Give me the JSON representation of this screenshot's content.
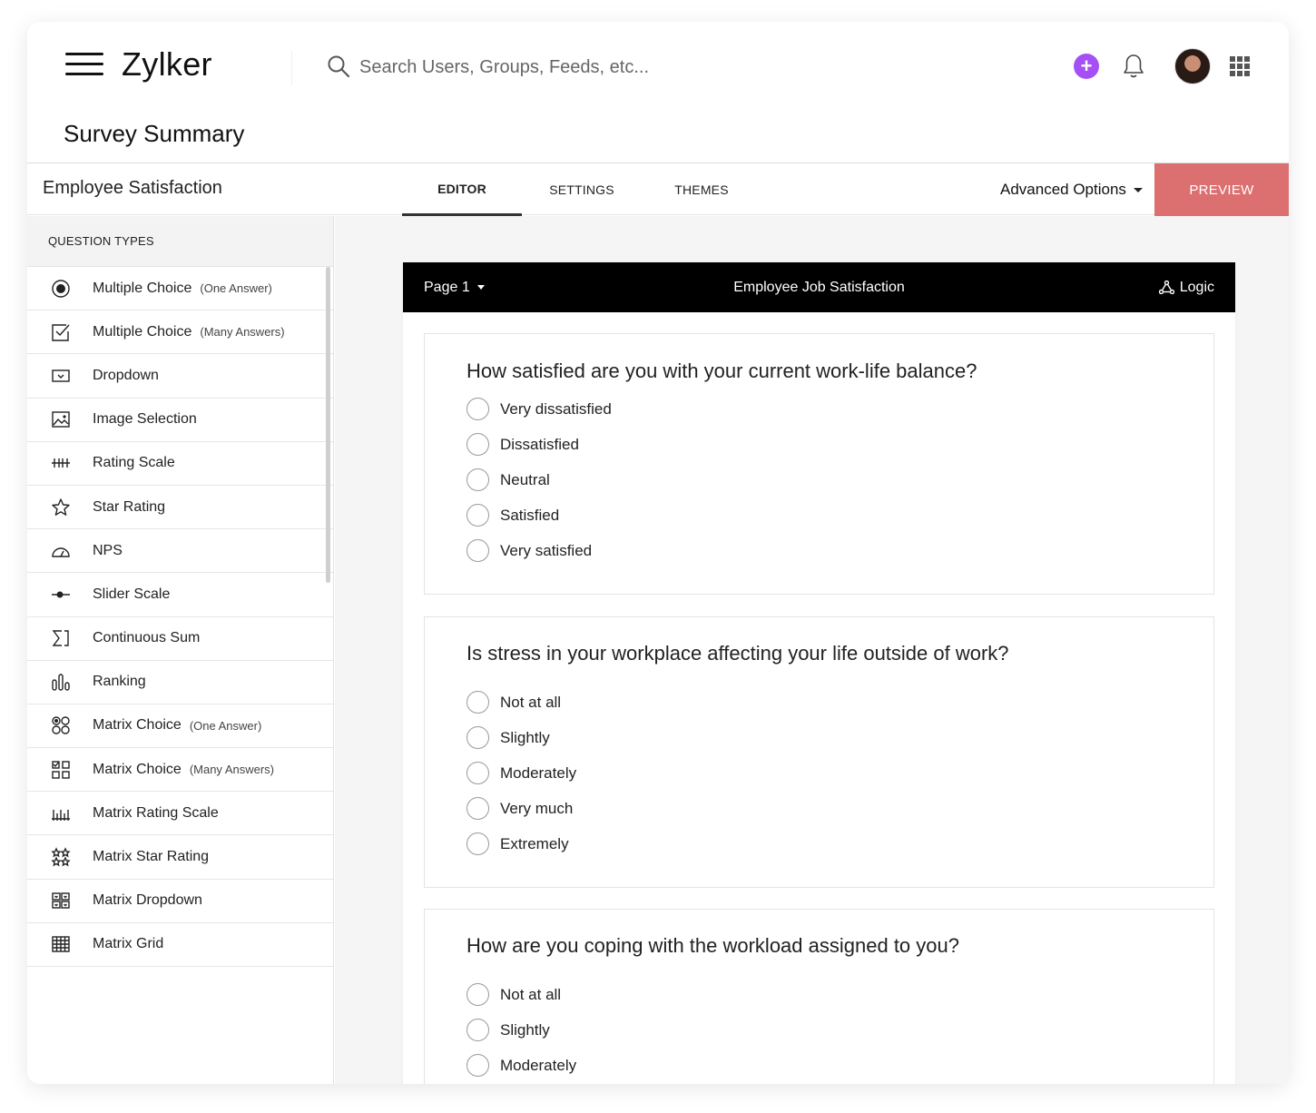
{
  "header": {
    "logo": "Zylker",
    "search_placeholder": "Search Users, Groups, Feeds, etc...",
    "plus_label": "+"
  },
  "page_title": "Survey Summary",
  "tabbar": {
    "survey_name": "Employee Satisfaction",
    "tabs": [
      {
        "label": "EDITOR",
        "active": true
      },
      {
        "label": "SETTINGS",
        "active": false
      },
      {
        "label": "THEMES",
        "active": false
      }
    ],
    "advanced_options": "Advanced Options",
    "preview": "PREVIEW"
  },
  "sidebar": {
    "heading": "QUESTION TYPES",
    "items": [
      {
        "label": "Multiple Choice",
        "sub": "(One Answer)",
        "icon": "radio-icon"
      },
      {
        "label": "Multiple Choice",
        "sub": "(Many Answers)",
        "icon": "checkbox-icon"
      },
      {
        "label": "Dropdown",
        "sub": "",
        "icon": "dropdown-icon"
      },
      {
        "label": "Image Selection",
        "sub": "",
        "icon": "image-icon"
      },
      {
        "label": "Rating Scale",
        "sub": "",
        "icon": "rating-scale-icon"
      },
      {
        "label": "Star Rating",
        "sub": "",
        "icon": "star-icon"
      },
      {
        "label": "NPS",
        "sub": "",
        "icon": "gauge-icon"
      },
      {
        "label": "Slider Scale",
        "sub": "",
        "icon": "slider-icon"
      },
      {
        "label": "Continuous Sum",
        "sub": "",
        "icon": "sum-icon"
      },
      {
        "label": "Ranking",
        "sub": "",
        "icon": "ranking-icon"
      },
      {
        "label": "Matrix Choice",
        "sub": "(One Answer)",
        "icon": "matrix-radio-icon"
      },
      {
        "label": "Matrix Choice",
        "sub": "(Many Answers)",
        "icon": "matrix-checkbox-icon"
      },
      {
        "label": "Matrix Rating Scale",
        "sub": "",
        "icon": "matrix-rating-icon"
      },
      {
        "label": "Matrix Star Rating",
        "sub": "",
        "icon": "matrix-star-icon"
      },
      {
        "label": "Matrix Dropdown",
        "sub": "",
        "icon": "matrix-dropdown-icon"
      },
      {
        "label": "Matrix Grid",
        "sub": "",
        "icon": "grid-icon"
      }
    ]
  },
  "page_bar": {
    "page_label": "Page 1",
    "survey_title": "Employee Job Satisfaction",
    "logic_label": "Logic"
  },
  "questions": [
    {
      "text": "How satisfied are you with your current work-life balance?",
      "options": [
        "Very dissatisfied",
        "Dissatisfied",
        "Neutral",
        "Satisfied",
        "Very satisfied"
      ]
    },
    {
      "text": "Is stress in your workplace affecting your life outside of work?",
      "options": [
        "Not at all",
        "Slightly",
        "Moderately",
        "Very much",
        "Extremely"
      ]
    },
    {
      "text": "How are you coping with the workload assigned to you?",
      "options": [
        "Not at all",
        "Slightly",
        "Moderately"
      ]
    }
  ],
  "colors": {
    "accent_purple": "#a550f5",
    "preview_red": "#dc6f6f",
    "page_bar": "#000000"
  }
}
